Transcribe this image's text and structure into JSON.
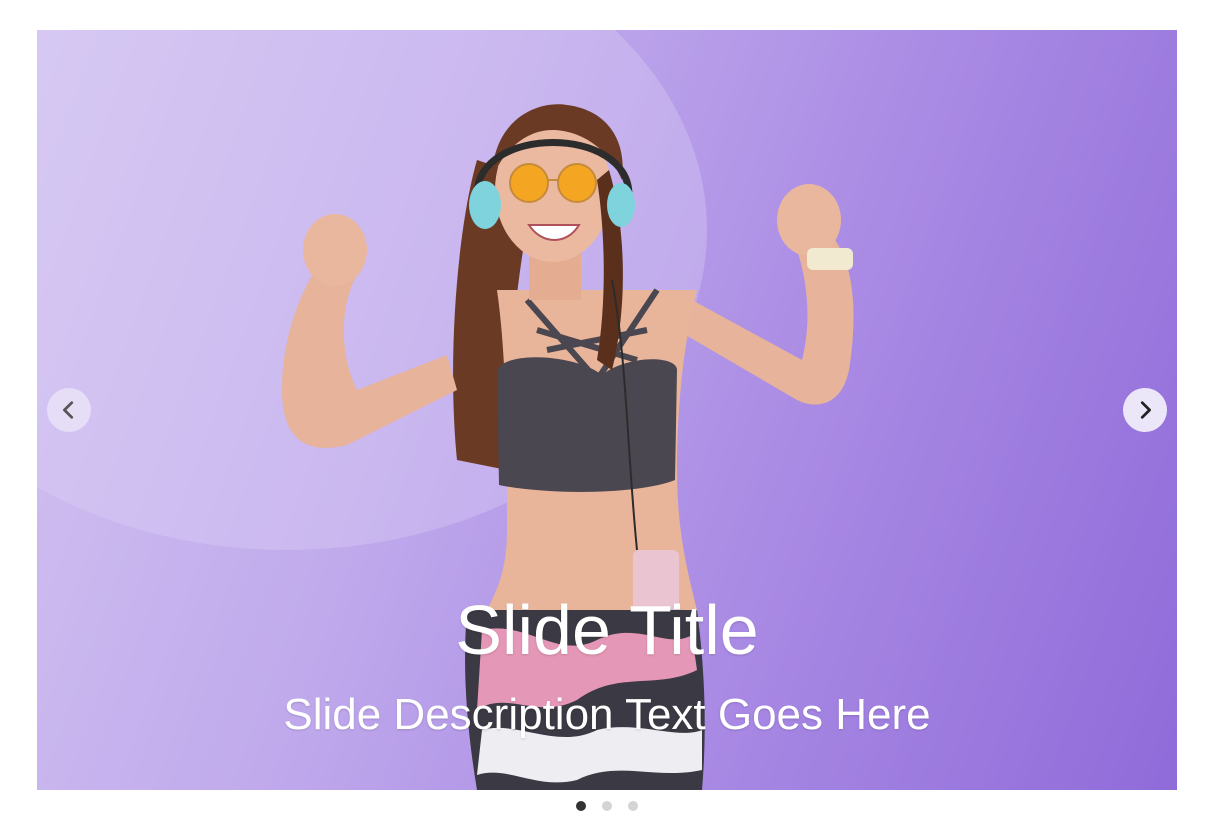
{
  "slider": {
    "title": "Slide Title",
    "description": "Slide Description Text Goes Here",
    "prev_icon": "chevron-left-icon",
    "next_icon": "chevron-right-icon",
    "slide_count": 3,
    "active_slide": 1
  },
  "colors": {
    "background_start": "#d3c4f1",
    "background_end": "#8f6bd9",
    "caption_text": "#ffffff",
    "dot_active": "#333333",
    "dot_inactive": "#d4d4d4"
  }
}
